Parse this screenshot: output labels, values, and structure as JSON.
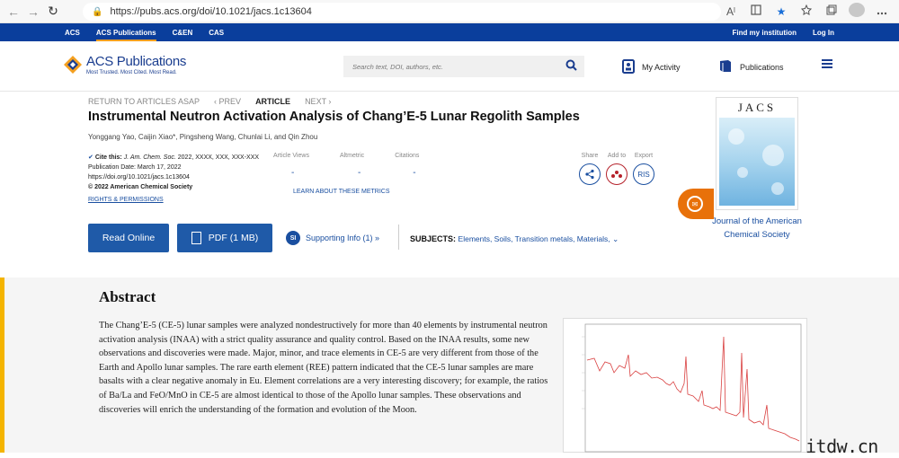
{
  "browser": {
    "url": "https://pubs.acs.org/doi/10.1021/jacs.1c13604",
    "back_glyph": "←",
    "forward_glyph": "→",
    "reload_glyph": "↻",
    "lock_glyph": "🔒",
    "read_aloud_glyph": "Aˡ",
    "star_glyph": "★",
    "icons": [
      "reader-icon",
      "favorites-icon",
      "collections-icon",
      "profile-icon",
      "menu-icon"
    ]
  },
  "topnav": {
    "items": [
      "ACS",
      "ACS Publications",
      "C&EN",
      "CAS"
    ],
    "active": "ACS Publications",
    "find_institution": "Find my institution",
    "login": "Log In"
  },
  "header": {
    "logo_title": "ACS Publications",
    "logo_tagline": "Most Trusted. Most Cited. Most Read.",
    "search_placeholder": "Search text, DOI, authors, etc.",
    "my_activity": "My Activity",
    "publications": "Publications"
  },
  "article": {
    "breadcrumbs": {
      "back": "RETURN TO ARTICLES ASAP",
      "prev": "‹ PREV",
      "current": "ARTICLE",
      "next": "NEXT ›"
    },
    "title": "Instrumental Neutron Activation Analysis of Chang’E-5 Lunar Regolith Samples",
    "authors": "Yonggang Yao, Caijin Xiao*, Pingsheng Wang, Chunlai Li, and Qin Zhou",
    "cite_label": "Cite this:",
    "cite_journal": "J. Am. Chem. Soc.",
    "cite_rest": "2022, XXXX, XXX, XXX-XXX",
    "pub_date": "Publication Date: March 17, 2022",
    "doi": "https://doi.org/10.1021/jacs.1c13604",
    "copyright": "© 2022 American Chemical Society",
    "rights": "RIGHTS & PERMISSIONS",
    "metrics": [
      {
        "label": "Article Views",
        "value": "-"
      },
      {
        "label": "Altmetric",
        "value": "-"
      },
      {
        "label": "Citations",
        "value": "-"
      }
    ],
    "learn_metrics": "LEARN ABOUT THESE METRICS",
    "share_labels": [
      "Share",
      "Add to",
      "Export"
    ],
    "export_ris": "RIS",
    "read_online": "Read Online",
    "pdf": "PDF (1 MB)",
    "si_badge": "SI",
    "supporting_info": "Supporting Info (1) »",
    "subjects_label": "SUBJECTS:",
    "subjects_values": "Elements, Soils, Transition metals, Materials,"
  },
  "journal": {
    "cover_title": "JACS",
    "name": "Journal of the American Chemical Society"
  },
  "abstract": {
    "heading": "Abstract",
    "text": "The Chang’E-5 (CE-5) lunar samples were analyzed nondestructively for more than 40 elements by instrumental neutron activation analysis (INAA) with a strict quality assurance and quality control. Based on the INAA results, some new observations and discoveries were made. Major, minor, and trace elements in CE-5 are very different from those of the Earth and Apollo lunar samples. The rare earth element (REE) pattern indicated that the CE-5 lunar samples are mare basalts with a clear negative anomaly in Eu. Element correlations are a very interesting discovery; for example, the ratios of Ba/La and FeO/MnO in CE-5 are almost identical to those of the Apollo lunar samples. These observations and discoveries will enrich the understanding of the formation and evolution of the Moon."
  },
  "watermark": "itdw.cn",
  "colors": {
    "topnav_bg": "#0a3e9c",
    "brand_blue": "#1f5aa8",
    "accent_orange": "#e8710a",
    "abstract_bar": "#f4b400",
    "spectrum_red": "#d94040"
  }
}
